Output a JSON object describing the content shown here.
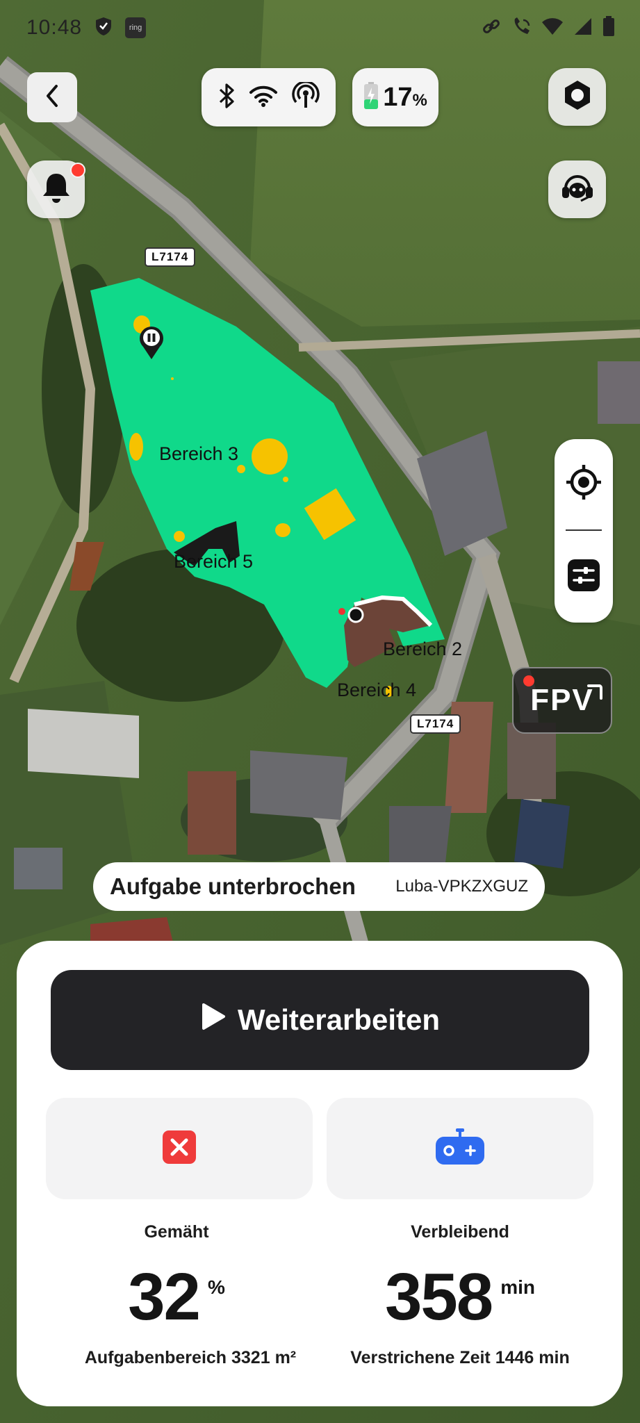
{
  "status_bar": {
    "time": "10:48",
    "left_icons": [
      "shield-icon",
      "ring-app-icon"
    ],
    "right_icons": [
      "link-icon",
      "call-wifi-icon",
      "wifi-icon",
      "signal-icon",
      "battery-icon"
    ],
    "ring_text": "ring"
  },
  "top_bar": {
    "connectivity_icons": [
      "bluetooth-icon",
      "wifi-icon",
      "rtk-antenna-icon"
    ],
    "battery_value": "17",
    "battery_unit": "%",
    "battery_level": 0.17
  },
  "map": {
    "road_labels": [
      "L7174",
      "L7174"
    ],
    "zones": [
      "Bereich 3",
      "Bereich 5",
      "Bereich 2",
      "Bereich 4"
    ],
    "colors": {
      "lawn": "#10d98a",
      "obstacle": "#f6c200",
      "dark_zone": "#1a1a1a"
    }
  },
  "side_tools": {
    "locate_icon": "crosshair-icon",
    "settings_icon": "sliders-icon",
    "fpv_label": "FPV"
  },
  "task": {
    "status": "Aufgabe unterbrochen",
    "device": "Luba-VPKZXGUZ"
  },
  "sheet": {
    "primary_button": "Weiterarbeiten",
    "tiles": [
      "cancel-icon",
      "gamepad-icon"
    ],
    "stats": {
      "mowed_label": "Gemäht",
      "mowed_value": "32",
      "mowed_unit": "%",
      "task_area": "Aufgabenbereich 3321 m²",
      "remaining_label": "Verbleibend",
      "remaining_value": "358",
      "remaining_unit": "min",
      "elapsed": "Verstrichene Zeit 1446 min"
    }
  }
}
